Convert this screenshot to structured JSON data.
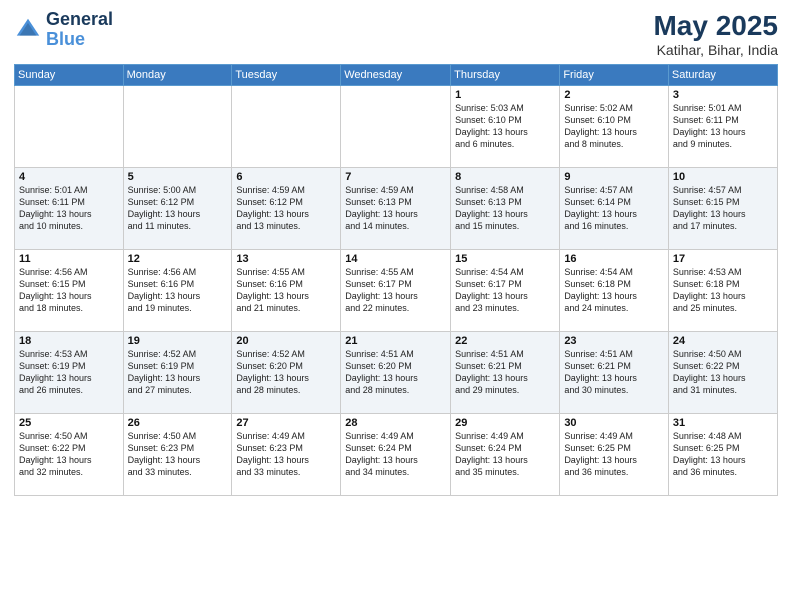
{
  "header": {
    "logo_line1": "General",
    "logo_line2": "Blue",
    "month": "May 2025",
    "location": "Katihar, Bihar, India"
  },
  "weekdays": [
    "Sunday",
    "Monday",
    "Tuesday",
    "Wednesday",
    "Thursday",
    "Friday",
    "Saturday"
  ],
  "weeks": [
    [
      {
        "day": "",
        "info": ""
      },
      {
        "day": "",
        "info": ""
      },
      {
        "day": "",
        "info": ""
      },
      {
        "day": "",
        "info": ""
      },
      {
        "day": "1",
        "info": "Sunrise: 5:03 AM\nSunset: 6:10 PM\nDaylight: 13 hours\nand 6 minutes."
      },
      {
        "day": "2",
        "info": "Sunrise: 5:02 AM\nSunset: 6:10 PM\nDaylight: 13 hours\nand 8 minutes."
      },
      {
        "day": "3",
        "info": "Sunrise: 5:01 AM\nSunset: 6:11 PM\nDaylight: 13 hours\nand 9 minutes."
      }
    ],
    [
      {
        "day": "4",
        "info": "Sunrise: 5:01 AM\nSunset: 6:11 PM\nDaylight: 13 hours\nand 10 minutes."
      },
      {
        "day": "5",
        "info": "Sunrise: 5:00 AM\nSunset: 6:12 PM\nDaylight: 13 hours\nand 11 minutes."
      },
      {
        "day": "6",
        "info": "Sunrise: 4:59 AM\nSunset: 6:12 PM\nDaylight: 13 hours\nand 13 minutes."
      },
      {
        "day": "7",
        "info": "Sunrise: 4:59 AM\nSunset: 6:13 PM\nDaylight: 13 hours\nand 14 minutes."
      },
      {
        "day": "8",
        "info": "Sunrise: 4:58 AM\nSunset: 6:13 PM\nDaylight: 13 hours\nand 15 minutes."
      },
      {
        "day": "9",
        "info": "Sunrise: 4:57 AM\nSunset: 6:14 PM\nDaylight: 13 hours\nand 16 minutes."
      },
      {
        "day": "10",
        "info": "Sunrise: 4:57 AM\nSunset: 6:15 PM\nDaylight: 13 hours\nand 17 minutes."
      }
    ],
    [
      {
        "day": "11",
        "info": "Sunrise: 4:56 AM\nSunset: 6:15 PM\nDaylight: 13 hours\nand 18 minutes."
      },
      {
        "day": "12",
        "info": "Sunrise: 4:56 AM\nSunset: 6:16 PM\nDaylight: 13 hours\nand 19 minutes."
      },
      {
        "day": "13",
        "info": "Sunrise: 4:55 AM\nSunset: 6:16 PM\nDaylight: 13 hours\nand 21 minutes."
      },
      {
        "day": "14",
        "info": "Sunrise: 4:55 AM\nSunset: 6:17 PM\nDaylight: 13 hours\nand 22 minutes."
      },
      {
        "day": "15",
        "info": "Sunrise: 4:54 AM\nSunset: 6:17 PM\nDaylight: 13 hours\nand 23 minutes."
      },
      {
        "day": "16",
        "info": "Sunrise: 4:54 AM\nSunset: 6:18 PM\nDaylight: 13 hours\nand 24 minutes."
      },
      {
        "day": "17",
        "info": "Sunrise: 4:53 AM\nSunset: 6:18 PM\nDaylight: 13 hours\nand 25 minutes."
      }
    ],
    [
      {
        "day": "18",
        "info": "Sunrise: 4:53 AM\nSunset: 6:19 PM\nDaylight: 13 hours\nand 26 minutes."
      },
      {
        "day": "19",
        "info": "Sunrise: 4:52 AM\nSunset: 6:19 PM\nDaylight: 13 hours\nand 27 minutes."
      },
      {
        "day": "20",
        "info": "Sunrise: 4:52 AM\nSunset: 6:20 PM\nDaylight: 13 hours\nand 28 minutes."
      },
      {
        "day": "21",
        "info": "Sunrise: 4:51 AM\nSunset: 6:20 PM\nDaylight: 13 hours\nand 28 minutes."
      },
      {
        "day": "22",
        "info": "Sunrise: 4:51 AM\nSunset: 6:21 PM\nDaylight: 13 hours\nand 29 minutes."
      },
      {
        "day": "23",
        "info": "Sunrise: 4:51 AM\nSunset: 6:21 PM\nDaylight: 13 hours\nand 30 minutes."
      },
      {
        "day": "24",
        "info": "Sunrise: 4:50 AM\nSunset: 6:22 PM\nDaylight: 13 hours\nand 31 minutes."
      }
    ],
    [
      {
        "day": "25",
        "info": "Sunrise: 4:50 AM\nSunset: 6:22 PM\nDaylight: 13 hours\nand 32 minutes."
      },
      {
        "day": "26",
        "info": "Sunrise: 4:50 AM\nSunset: 6:23 PM\nDaylight: 13 hours\nand 33 minutes."
      },
      {
        "day": "27",
        "info": "Sunrise: 4:49 AM\nSunset: 6:23 PM\nDaylight: 13 hours\nand 33 minutes."
      },
      {
        "day": "28",
        "info": "Sunrise: 4:49 AM\nSunset: 6:24 PM\nDaylight: 13 hours\nand 34 minutes."
      },
      {
        "day": "29",
        "info": "Sunrise: 4:49 AM\nSunset: 6:24 PM\nDaylight: 13 hours\nand 35 minutes."
      },
      {
        "day": "30",
        "info": "Sunrise: 4:49 AM\nSunset: 6:25 PM\nDaylight: 13 hours\nand 36 minutes."
      },
      {
        "day": "31",
        "info": "Sunrise: 4:48 AM\nSunset: 6:25 PM\nDaylight: 13 hours\nand 36 minutes."
      }
    ]
  ]
}
